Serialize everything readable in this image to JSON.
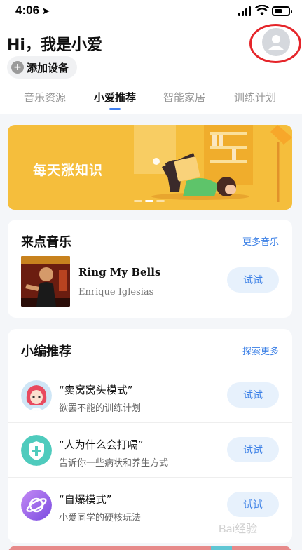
{
  "status_bar": {
    "time": "4:06",
    "location_arrow": "➤"
  },
  "header": {
    "greeting": "Hi，我是小爱",
    "add_device": {
      "icon": "+",
      "label": "添加设备"
    },
    "avatar_icon": "user-avatar-icon"
  },
  "tabs": [
    {
      "label": "音乐资源",
      "active": false
    },
    {
      "label": "小爱推荐",
      "active": true
    },
    {
      "label": "智能家居",
      "active": false
    },
    {
      "label": "训练计划",
      "active": false
    }
  ],
  "banner": {
    "title": "每天涨知识",
    "slide_count": 3,
    "active_slide": 2
  },
  "music_card": {
    "title": "来点音乐",
    "more": "更多音乐",
    "song": {
      "title": "Ring My Bells",
      "artist": "Enrique Iglesias"
    },
    "try_label": "试试"
  },
  "editor_card": {
    "title": "小编推荐",
    "more": "探索更多",
    "items": [
      {
        "name": "“卖窝窝头模式”",
        "desc": "欲罢不能的训练计划",
        "try_label": "试试",
        "icon": "anime-girl-avatar-icon"
      },
      {
        "name": "“人为什么会打嗝”",
        "desc": "告诉你一些病状和养生方式",
        "try_label": "试试",
        "icon": "health-shield-icon"
      },
      {
        "name": "“自爆模式”",
        "desc": "小爱同学的硬核玩法",
        "try_label": "试试",
        "icon": "planet-icon"
      }
    ]
  },
  "watermark": "Bai经验",
  "colors": {
    "accent": "#3a7fe6",
    "banner": "#f5be3c",
    "highlight_ring": "#e5252a"
  }
}
